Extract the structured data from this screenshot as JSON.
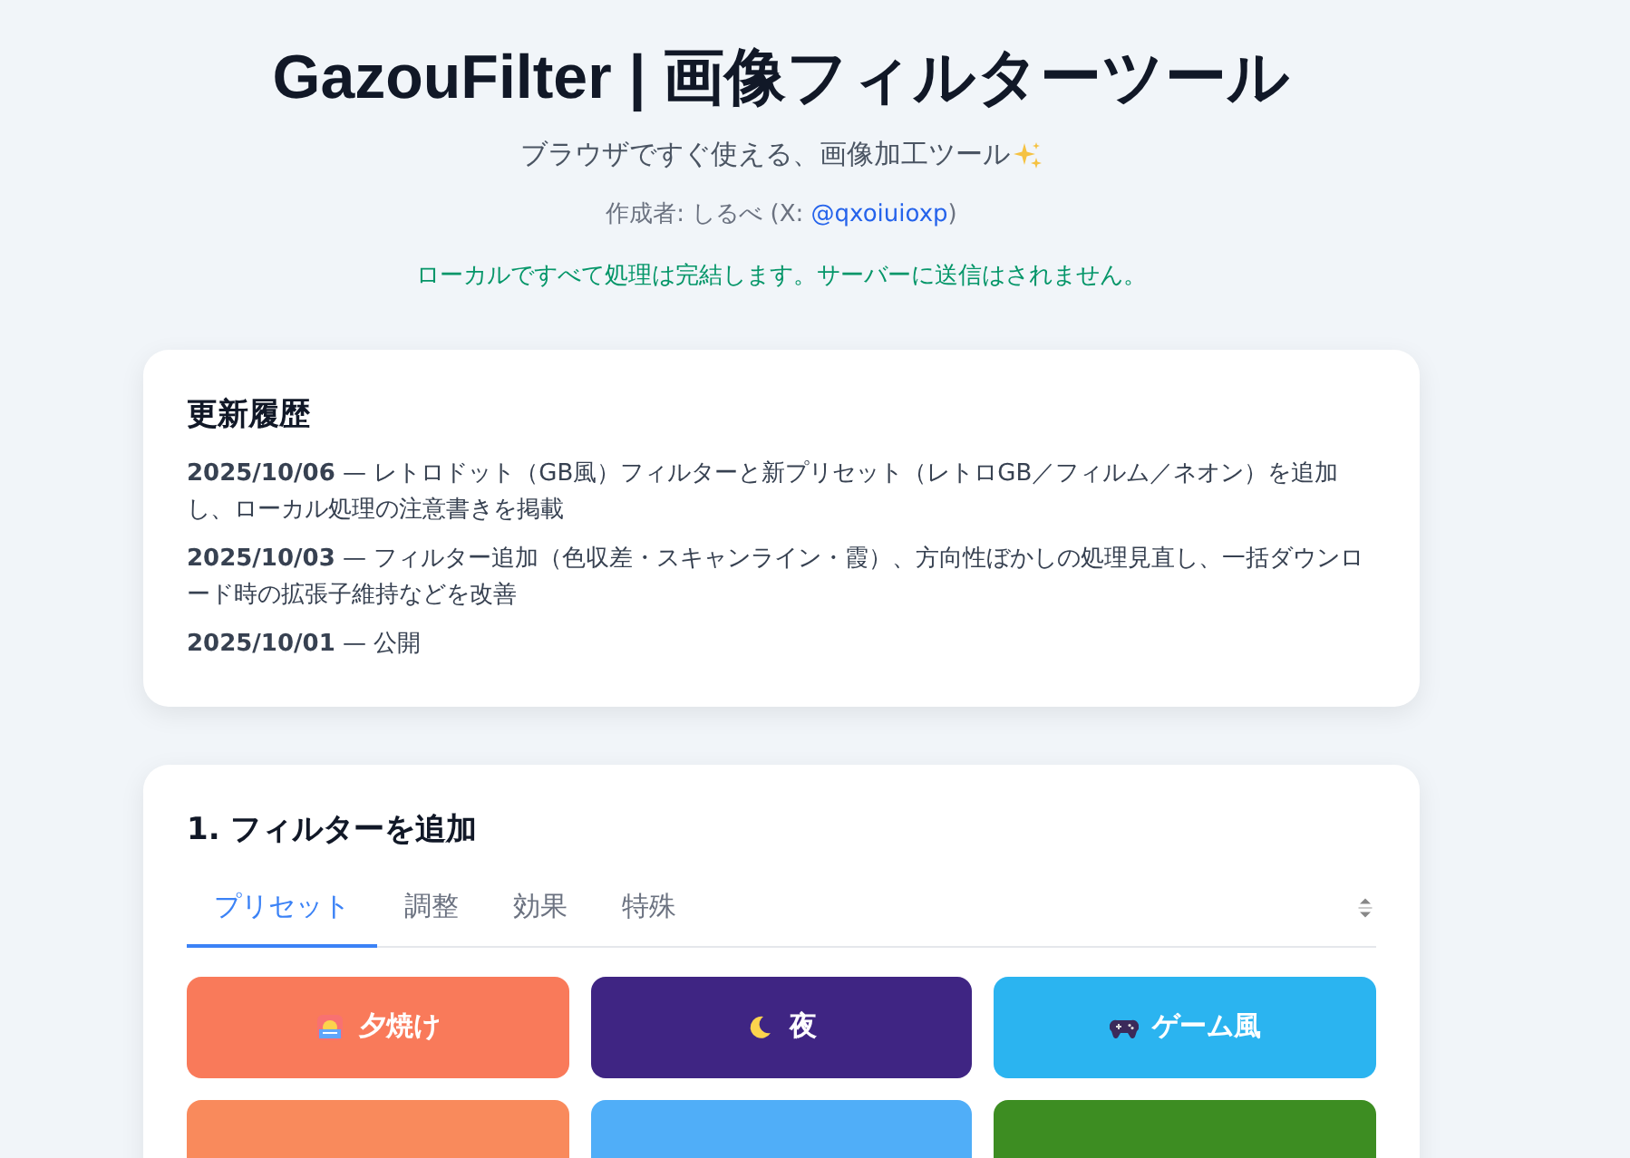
{
  "header": {
    "title": "GazouFilter | 画像フィルターツール",
    "subtitle": "ブラウザですぐ使える、画像加工ツール",
    "author_prefix": "作成者: しるべ (X: ",
    "author_link": "@qxoiuioxp",
    "author_suffix": ")",
    "notice": "ローカルですべて処理は完結します。サーバーに送信はされません。"
  },
  "changelog": {
    "title": "更新履歴",
    "entries": [
      {
        "text": "**2025/10/06** — レトロドット（GB風）フィルターと新プリセット（レトロGB／フィルム／ネオン）を追加し、ローカル処理の注意書きを掲載"
      },
      {
        "text": "**2025/10/03** — フィルター追加（色収差・スキャンライン・霞）、方向性ぼかしの処理見直し、一括ダウンロード時の拡張子維持などを改善"
      },
      {
        "text": "**2025/10/01** — 公開"
      }
    ]
  },
  "filters": {
    "title": "1. フィルターを追加",
    "tabs": [
      {
        "label": "プリセット",
        "selected": true
      },
      {
        "label": "調整",
        "selected": false
      },
      {
        "label": "効果",
        "selected": false
      },
      {
        "label": "特殊",
        "selected": false
      }
    ],
    "presets": [
      {
        "label": "夕焼け",
        "kind": "sunset",
        "color": "#f97a5a"
      },
      {
        "label": "夜",
        "kind": "night",
        "color": "#3f2583"
      },
      {
        "label": "ゲーム風",
        "kind": "game",
        "color": "#2bb4f0"
      },
      {
        "kind": "plain",
        "color": "#f98a5c"
      },
      {
        "kind": "plain",
        "color": "#50aef8"
      },
      {
        "kind": "plain",
        "color": "#3d8d22"
      }
    ]
  }
}
